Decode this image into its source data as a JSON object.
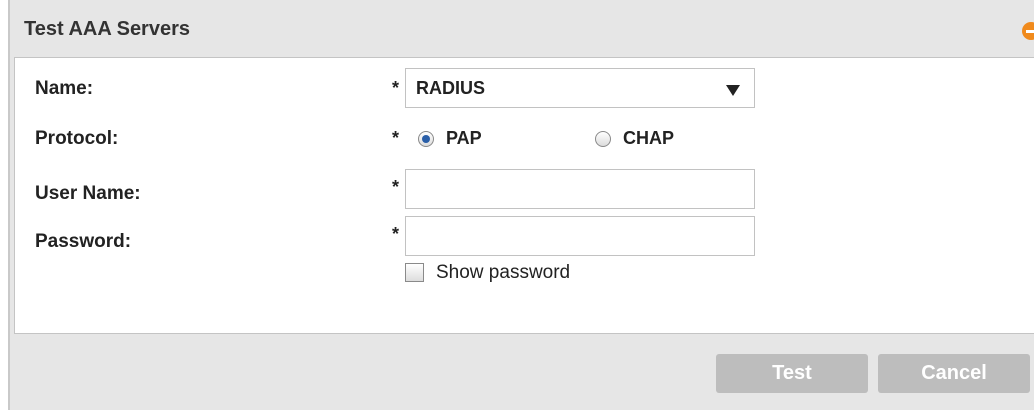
{
  "dialog": {
    "title": "Test AAA Servers",
    "collapse_icon": "minus-circle-icon",
    "accent_color": "#f08a1c"
  },
  "form": {
    "name": {
      "label": "Name:",
      "required_marker": "*",
      "selected_value": "RADIUS"
    },
    "protocol": {
      "label": "Protocol:",
      "required_marker": "*",
      "options": [
        {
          "label": "PAP",
          "checked": true
        },
        {
          "label": "CHAP",
          "checked": false
        }
      ]
    },
    "user_name": {
      "label": "User Name:",
      "required_marker": "*",
      "value": ""
    },
    "password": {
      "label": "Password:",
      "required_marker": "*",
      "value": ""
    },
    "show_password": {
      "label": "Show password",
      "checked": false
    }
  },
  "buttons": {
    "test_label": "Test",
    "cancel_label": "Cancel"
  }
}
